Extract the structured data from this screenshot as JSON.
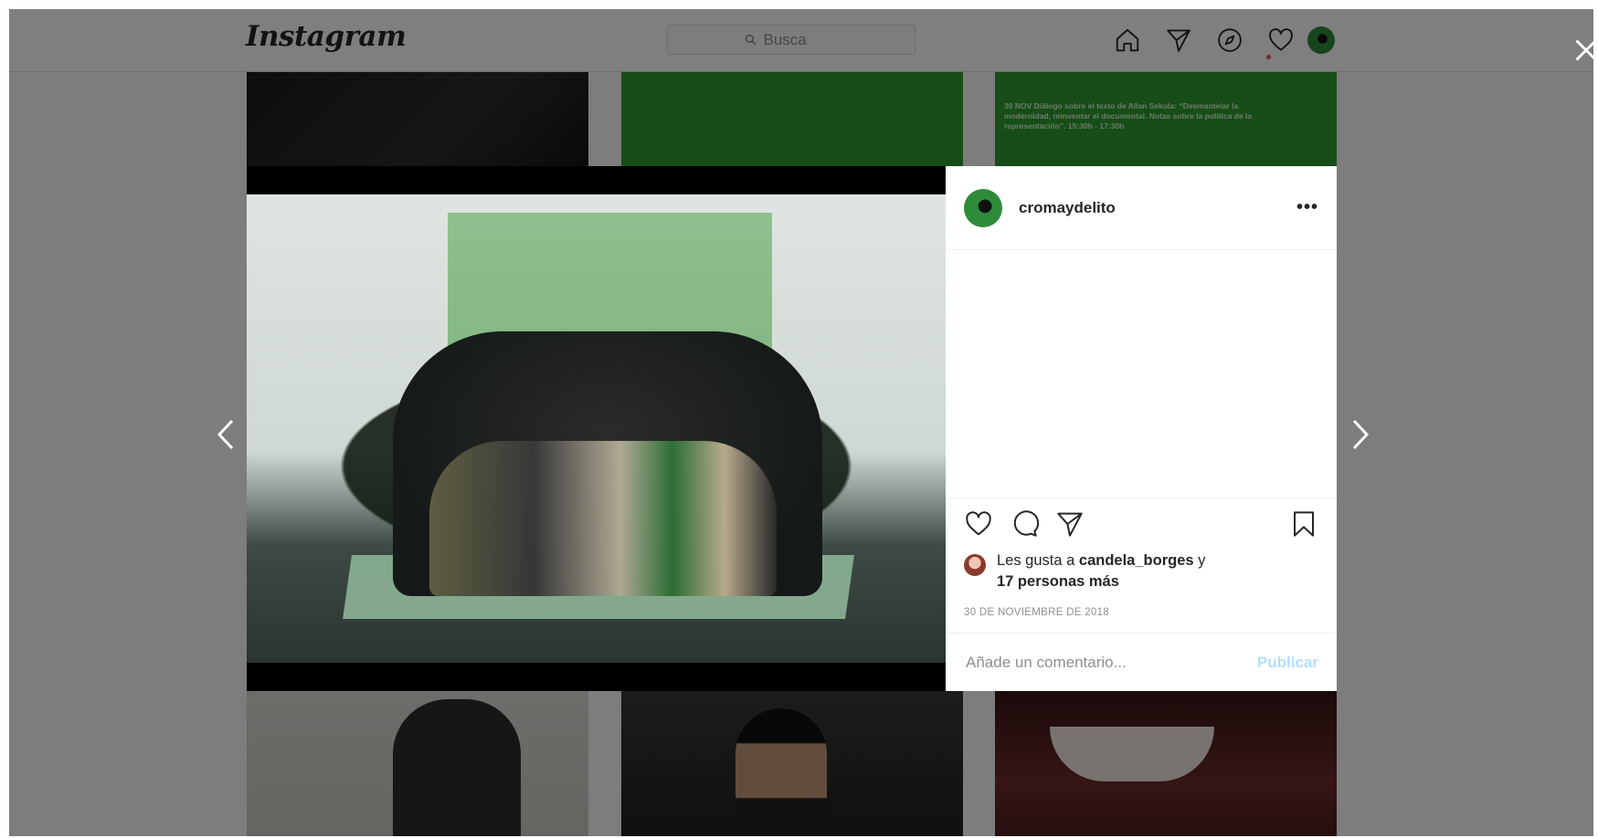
{
  "header": {
    "logo": "Instagram",
    "search_placeholder": "Busca"
  },
  "background_grid": {
    "tile_text": "30 NOV Diálogo sobre el texto de Allan Sekula: “Desmantelar la modernidad, reinventar el documental. Notas sobre la política de la representación”. 15:30h - 17:30h"
  },
  "post": {
    "username": "cromaydelito",
    "more_label": "•••",
    "likes_prefix": "Les gusta a ",
    "likes_user": "candela_borges",
    "likes_conj": " y",
    "likes_others": "17 personas más",
    "date": "30 DE NOVIEMBRE DE 2018",
    "comment_placeholder": "Añade un comentario...",
    "publish_label": "Publicar"
  },
  "colors": {
    "link_disabled": "#b2dffc",
    "notification_dot": "#ed4956",
    "backdrop_green": "#2e9b2e"
  },
  "icons": [
    "search-icon",
    "home-icon",
    "direct-icon",
    "explore-icon",
    "activity-heart-icon",
    "close-icon",
    "chevron-left-icon",
    "chevron-right-icon",
    "like-icon",
    "comment-icon",
    "share-icon",
    "bookmark-icon"
  ]
}
